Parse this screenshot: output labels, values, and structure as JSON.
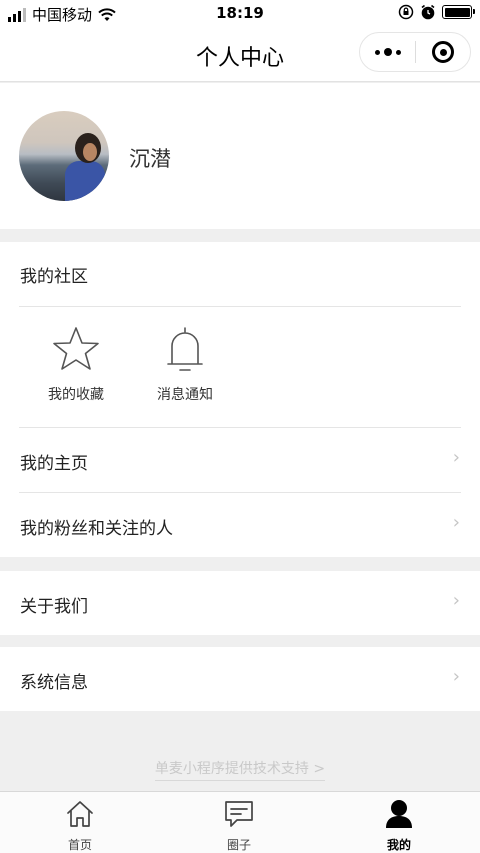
{
  "status_bar": {
    "carrier": "中国移动",
    "time": "18:19"
  },
  "navbar": {
    "title": "个人中心"
  },
  "profile": {
    "name": "沉潜"
  },
  "community": {
    "title": "我的社区",
    "items": [
      {
        "label": "我的收藏",
        "icon": "star-icon"
      },
      {
        "label": "消息通知",
        "icon": "bell-icon"
      }
    ]
  },
  "menu": {
    "homepage": "我的主页",
    "fans": "我的粉丝和关注的人",
    "about": "关于我们",
    "system": "系统信息",
    "chevron": "›"
  },
  "footer": {
    "support_text": "单麦小程序提供技术支持 >"
  },
  "tabbar": {
    "items": [
      {
        "label": "首页",
        "icon": "home-icon"
      },
      {
        "label": "圈子",
        "icon": "chat-icon"
      },
      {
        "label": "我的",
        "icon": "person-icon",
        "active": true
      }
    ]
  },
  "colors": {
    "background": "#efefef",
    "card": "#ffffff",
    "chevron": "#c5c5c5",
    "footer_text": "#c9c9c9"
  }
}
